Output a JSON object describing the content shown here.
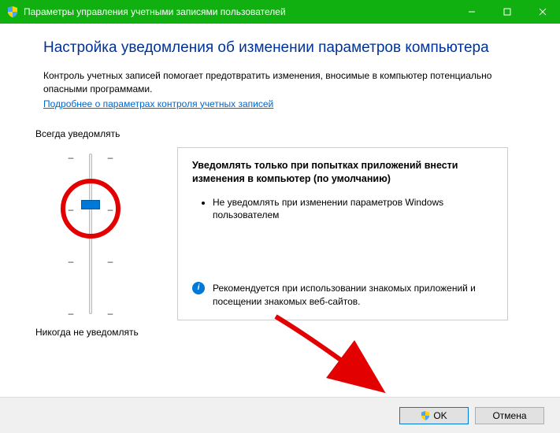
{
  "window": {
    "title": "Параметры управления учетными записями пользователей"
  },
  "heading": "Настройка уведомления об изменении параметров компьютера",
  "description": "Контроль учетных записей помогает предотвратить изменения, вносимые в компьютер потенциально опасными программами.",
  "link_text": "Подробнее о параметрах контроля учетных записей",
  "slider": {
    "top_label": "Всегда уведомлять",
    "bottom_label": "Никогда не уведомлять"
  },
  "detail": {
    "title": "Уведомлять только при попытках приложений внести изменения в компьютер (по умолчанию)",
    "bullet1": "Не уведомлять при изменении параметров Windows пользователем",
    "recommend": "Рекомендуется при использовании знакомых приложений и посещении знакомых веб-сайтов."
  },
  "buttons": {
    "ok": "OK",
    "cancel": "Отмена"
  }
}
